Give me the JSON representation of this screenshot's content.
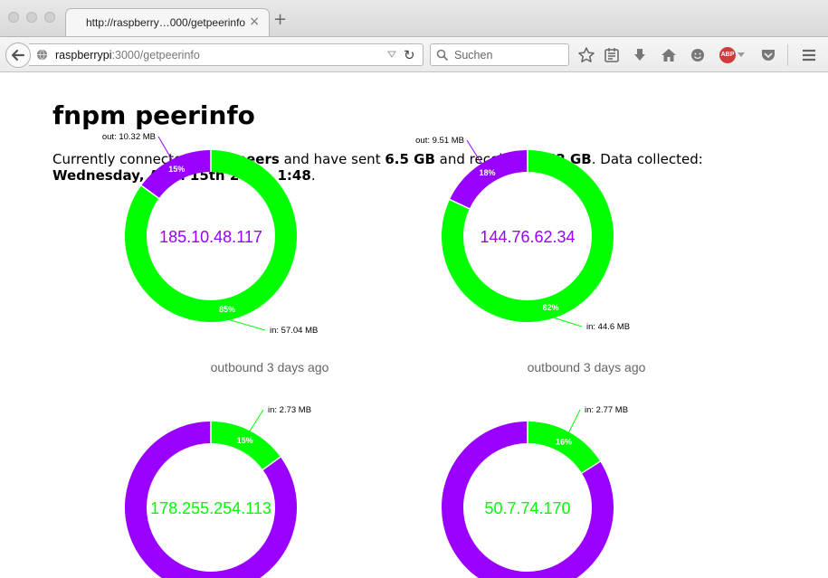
{
  "browser": {
    "tab_title": "http://raspberry…000/getpeerinfo",
    "tab_close": "×",
    "new_tab": "+",
    "url_host": "raspberrypi",
    "url_rest": ":3000/getpeerinfo",
    "search_placeholder": "Suchen"
  },
  "page": {
    "title": "fnpm peerinfo",
    "summary": {
      "t1": "Currently connected to ",
      "peers": "34 peers",
      "t2": " and have sent ",
      "sent": "6.5 GB",
      "t3": " and received ",
      "received": "0.62 GB",
      "t4": ". Data collected: ",
      "collected": "Wednesday, April 15th 2015, 1:48",
      "t5": "."
    }
  },
  "colors": {
    "in": "#00ff00",
    "out": "#9900ff"
  },
  "peers": [
    {
      "ip": "185.10.48.117",
      "caption": "outbound 3 days ago",
      "out_label": "out: 10.32 MB",
      "in_label": "in: 57.04 MB",
      "out_pct": "15%",
      "in_pct": "85%",
      "out_frac": 0.15,
      "order": "in-first"
    },
    {
      "ip": "144.76.62.34",
      "caption": "outbound 3 days ago",
      "out_label": "out: 9.51 MB",
      "in_label": "in: 44.6 MB",
      "out_pct": "18%",
      "in_pct": "82%",
      "out_frac": 0.18,
      "order": "in-first"
    },
    {
      "ip": "178.255.254.113",
      "caption": "",
      "out_label": "",
      "in_label": "in: 2.73 MB",
      "out_pct": "",
      "in_pct": "15%",
      "in_frac": 0.15,
      "order": "in-first-top"
    },
    {
      "ip": "50.7.74.170",
      "caption": "",
      "out_label": "",
      "in_label": "in: 2.77 MB",
      "out_pct": "",
      "in_pct": "16%",
      "in_frac": 0.16,
      "order": "in-first-top"
    }
  ]
}
